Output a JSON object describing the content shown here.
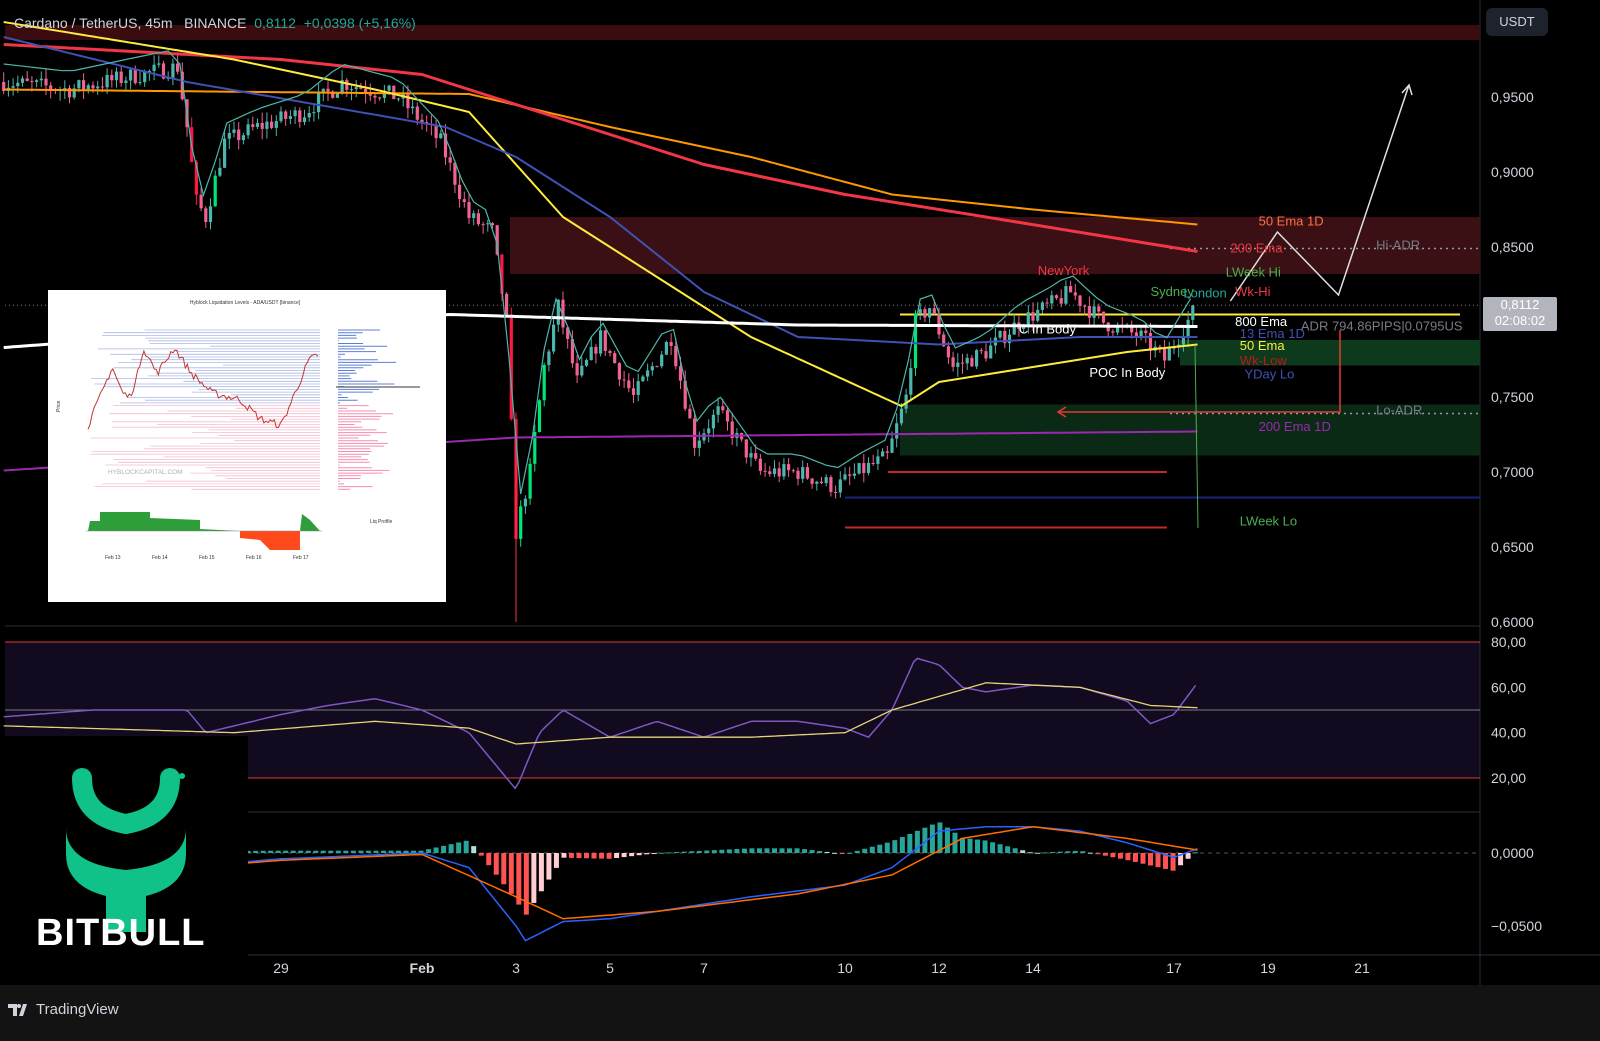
{
  "header": {
    "symbol": "Cardano / TetherUS, 45m",
    "exchange": "BINANCE",
    "last": "0,8112",
    "change": "+0,0398 (+5,16%)"
  },
  "currency_button": "USDT",
  "price_box": {
    "price": "0,8112",
    "countdown": "02:08:02"
  },
  "footer": {
    "brand": "TradingView"
  },
  "logo": {
    "text": "BITBULL"
  },
  "colors": {
    "up": "#26a69a",
    "down": "#f23645",
    "bright_up": "#00e676",
    "bg": "#000000",
    "logo_green": "#10c28a"
  },
  "chart_data": {
    "type": "candlestick",
    "title": "Cardano / TetherUS, 45m",
    "x_axis": {
      "unit": "days since Jan 29",
      "ticks": [
        {
          "day": 0,
          "label": "29"
        },
        {
          "day": 3,
          "label": "Feb"
        },
        {
          "day": 5,
          "label": "3"
        },
        {
          "day": 7,
          "label": "5"
        },
        {
          "day": 9,
          "label": "7"
        },
        {
          "day": 12,
          "label": "10"
        },
        {
          "day": 14,
          "label": "12"
        },
        {
          "day": 16,
          "label": "14"
        },
        {
          "day": 19,
          "label": "17"
        },
        {
          "day": 21,
          "label": "19"
        },
        {
          "day": 23,
          "label": "21"
        }
      ]
    },
    "price_axis": {
      "ylim": [
        0.6,
        1.0
      ],
      "ticks": [
        {
          "v": 0.95,
          "label": "0,9500"
        },
        {
          "v": 0.9,
          "label": "0,9000"
        },
        {
          "v": 0.85,
          "label": "0,8500"
        },
        {
          "v": 0.75,
          "label": "0,7500"
        },
        {
          "v": 0.7,
          "label": "0,7000"
        },
        {
          "v": 0.65,
          "label": "0,6500"
        },
        {
          "v": 0.6,
          "label": "0,6000"
        }
      ]
    },
    "price_path": [
      [
        -5.9,
        0.96
      ],
      [
        -4.5,
        0.955
      ],
      [
        -3,
        0.965
      ],
      [
        -2.2,
        0.97
      ],
      [
        -2.0,
        0.93
      ],
      [
        -1.8,
        0.88
      ],
      [
        -1.6,
        0.87
      ],
      [
        -1.2,
        0.92
      ],
      [
        -0.5,
        0.93
      ],
      [
        0.5,
        0.94
      ],
      [
        1.3,
        0.96
      ],
      [
        2.5,
        0.95
      ],
      [
        3.4,
        0.92
      ],
      [
        4.0,
        0.87
      ],
      [
        4.5,
        0.86
      ],
      [
        4.8,
        0.8
      ],
      [
        5.0,
        0.66
      ],
      [
        5.3,
        0.7
      ],
      [
        5.6,
        0.77
      ],
      [
        5.9,
        0.81
      ],
      [
        6.3,
        0.76
      ],
      [
        6.8,
        0.79
      ],
      [
        7.5,
        0.75
      ],
      [
        8.3,
        0.79
      ],
      [
        8.8,
        0.72
      ],
      [
        9.3,
        0.74
      ],
      [
        10.2,
        0.7
      ],
      [
        11,
        0.7
      ],
      [
        11.8,
        0.69
      ],
      [
        12.3,
        0.7
      ],
      [
        12.9,
        0.71
      ],
      [
        13.3,
        0.75
      ],
      [
        13.5,
        0.8
      ],
      [
        13.8,
        0.81
      ],
      [
        14.3,
        0.77
      ],
      [
        15,
        0.78
      ],
      [
        15.7,
        0.8
      ],
      [
        16.3,
        0.81
      ],
      [
        16.8,
        0.82
      ],
      [
        17.5,
        0.8
      ],
      [
        18.3,
        0.79
      ],
      [
        18.8,
        0.775
      ],
      [
        19.5,
        0.8112
      ]
    ],
    "indicators": [
      {
        "name": "50 Ema 1D",
        "color": "#ff9800",
        "points": [
          [
            -5.9,
            0.955
          ],
          [
            4,
            0.952
          ],
          [
            7,
            0.93
          ],
          [
            10,
            0.91
          ],
          [
            13,
            0.885
          ],
          [
            16,
            0.875
          ],
          [
            19.5,
            0.865
          ]
        ]
      },
      {
        "name": "200 Ema",
        "color": "#f23645",
        "points": [
          [
            -5.9,
            0.985
          ],
          [
            0,
            0.975
          ],
          [
            3,
            0.965
          ],
          [
            6,
            0.935
          ],
          [
            9,
            0.905
          ],
          [
            12,
            0.885
          ],
          [
            15,
            0.87
          ],
          [
            19.5,
            0.847
          ]
        ]
      },
      {
        "name": "50 Ema",
        "color": "#ffeb3b",
        "points": [
          [
            -5.9,
            1.0
          ],
          [
            -1,
            0.975
          ],
          [
            2,
            0.955
          ],
          [
            4,
            0.94
          ],
          [
            6,
            0.87
          ],
          [
            8,
            0.83
          ],
          [
            10,
            0.79
          ],
          [
            13.2,
            0.744
          ],
          [
            14,
            0.76
          ],
          [
            16,
            0.77
          ],
          [
            18,
            0.78
          ],
          [
            19.5,
            0.785
          ]
        ]
      },
      {
        "name": "13 Ema 1D",
        "color": "#3f51b5",
        "points": [
          [
            -5.9,
            0.99
          ],
          [
            -2,
            0.96
          ],
          [
            3.5,
            0.93
          ],
          [
            5,
            0.91
          ],
          [
            7,
            0.87
          ],
          [
            9,
            0.82
          ],
          [
            11,
            0.79
          ],
          [
            14,
            0.785
          ],
          [
            17,
            0.79
          ],
          [
            19.5,
            0.79
          ]
        ]
      },
      {
        "name": "800 Ema",
        "color": "#ffffff",
        "points": [
          [
            -5.9,
            0.783
          ],
          [
            3.6,
            0.805
          ],
          [
            11,
            0.798
          ],
          [
            19.5,
            0.797
          ]
        ]
      },
      {
        "name": "200 Ema 1D",
        "color": "#9c27b0",
        "points": [
          [
            -5.9,
            0.701
          ],
          [
            5,
            0.723
          ],
          [
            19.5,
            0.727
          ]
        ]
      }
    ],
    "levels": [
      {
        "name": "Hi-ADR",
        "price": 0.849,
        "style": "dotted"
      },
      {
        "name": "Lo-ADR",
        "price": 0.739,
        "style": "dotted"
      },
      {
        "name": "ADR 794.86PIPS|0.0795US",
        "price": 0.797
      }
    ],
    "labels": [
      {
        "text": "50 Ema 1D",
        "color": "#ff7043",
        "price": 0.867,
        "day": 20.8
      },
      {
        "text": "200 Ema",
        "color": "#f23645",
        "price": 0.849,
        "day": 20.2
      },
      {
        "text": "LWeek Hi",
        "color": "#4caf50",
        "price": 0.833,
        "day": 20.1
      },
      {
        "text": "NewYork",
        "color": "#f23645",
        "price": 0.834,
        "day": 16.1
      },
      {
        "text": "Sydney",
        "color": "#4caf50",
        "price": 0.82,
        "day": 18.5
      },
      {
        "text": "London",
        "color": "#26a69a",
        "price": 0.819,
        "day": 19.2
      },
      {
        "text": "Wk-Hi",
        "color": "#f23645",
        "price": 0.82,
        "day": 20.3
      },
      {
        "text": "800 Ema",
        "color": "#ffffff",
        "price": 0.8,
        "day": 20.3
      },
      {
        "text": "13 Ema 1D",
        "color": "#3f51b5",
        "price": 0.792,
        "day": 20.4
      },
      {
        "text": "50 Ema",
        "color": "#ffeb3b",
        "price": 0.784,
        "day": 20.4
      },
      {
        "text": "Wk-Low",
        "color": "#b71c1c",
        "price": 0.774,
        "day": 20.4
      },
      {
        "text": "YDay Lo",
        "color": "#3f51b5",
        "price": 0.765,
        "day": 20.5
      },
      {
        "text": "C In Body",
        "color": "#ffffff",
        "price": 0.795,
        "day": 15.7
      },
      {
        "text": "POC In Body",
        "color": "#ffffff",
        "price": 0.766,
        "day": 17.2
      },
      {
        "text": "200 Ema 1D",
        "color": "#9c27b0",
        "price": 0.73,
        "day": 20.8
      },
      {
        "text": "LWeek Lo",
        "color": "#4caf50",
        "price": 0.667,
        "day": 20.4
      },
      {
        "text": "Hi-ADR",
        "color": "#787b86",
        "price": 0.851,
        "day": 23.3
      },
      {
        "text": "Lo-ADR",
        "color": "#787b86",
        "price": 0.741,
        "day": 23.3
      },
      {
        "text": "ADR 794.86PIPS|0.0795US",
        "color": "#787b86",
        "price": 0.797,
        "day": 21.7
      }
    ],
    "projection": [
      [
        20.2,
        0.814
      ],
      [
        21.2,
        0.86
      ],
      [
        22.5,
        0.818
      ],
      [
        24.0,
        0.958
      ]
    ],
    "rsi": {
      "ticks": [
        {
          "v": 80,
          "label": "80,00"
        },
        {
          "v": 60,
          "label": "60,00"
        },
        {
          "v": 40,
          "label": "40,00"
        },
        {
          "v": 20,
          "label": "20,00"
        }
      ],
      "bands": [
        80,
        50,
        20
      ],
      "line": [
        [
          -5.9,
          47
        ],
        [
          -4,
          50
        ],
        [
          -2,
          50
        ],
        [
          -1.6,
          40
        ],
        [
          0,
          48
        ],
        [
          1,
          52
        ],
        [
          2,
          55
        ],
        [
          3,
          50
        ],
        [
          4,
          40
        ],
        [
          5,
          15
        ],
        [
          5.5,
          40
        ],
        [
          6,
          50
        ],
        [
          7,
          38
        ],
        [
          8,
          45
        ],
        [
          9,
          38
        ],
        [
          10,
          45
        ],
        [
          11,
          45
        ],
        [
          12,
          42
        ],
        [
          12.5,
          38
        ],
        [
          13,
          50
        ],
        [
          13.5,
          73
        ],
        [
          14,
          70
        ],
        [
          14.5,
          60
        ],
        [
          15,
          58
        ],
        [
          16,
          61
        ],
        [
          17,
          60
        ],
        [
          18,
          54
        ],
        [
          18.5,
          44
        ],
        [
          19,
          48
        ],
        [
          19.5,
          62
        ]
      ],
      "ma": [
        [
          -5.9,
          43
        ],
        [
          -1,
          40
        ],
        [
          2,
          45
        ],
        [
          4,
          42
        ],
        [
          5,
          35
        ],
        [
          7,
          38
        ],
        [
          10,
          38
        ],
        [
          12,
          40
        ],
        [
          13,
          50
        ],
        [
          15,
          62
        ],
        [
          17,
          60
        ],
        [
          18.5,
          52
        ],
        [
          19.5,
          51
        ]
      ]
    },
    "macd": {
      "ticks": [
        {
          "v": 0,
          "label": "0,0000"
        },
        {
          "v": -0.05,
          "label": "−0,0500"
        }
      ],
      "macd": [
        [
          -5.9,
          -0.017
        ],
        [
          -3,
          -0.012
        ],
        [
          0,
          -0.004
        ],
        [
          3,
          0
        ],
        [
          4,
          -0.01
        ],
        [
          5,
          -0.05
        ],
        [
          5.2,
          -0.06
        ],
        [
          6,
          -0.047
        ],
        [
          7,
          -0.045
        ],
        [
          8,
          -0.04
        ],
        [
          10,
          -0.03
        ],
        [
          12,
          -0.022
        ],
        [
          13,
          -0.01
        ],
        [
          14,
          0.015
        ],
        [
          15,
          0.018
        ],
        [
          16,
          0.018
        ],
        [
          17,
          0.015
        ],
        [
          18,
          0.007
        ],
        [
          19,
          -0.003
        ],
        [
          19.5,
          0.003
        ]
      ],
      "signal": [
        [
          -5.9,
          -0.02
        ],
        [
          0,
          -0.005
        ],
        [
          3,
          -0.001
        ],
        [
          5,
          -0.03
        ],
        [
          6,
          -0.045
        ],
        [
          8,
          -0.04
        ],
        [
          11,
          -0.028
        ],
        [
          13,
          -0.015
        ],
        [
          14.5,
          0.01
        ],
        [
          16,
          0.018
        ],
        [
          18,
          0.01
        ],
        [
          19.5,
          0.002
        ]
      ]
    },
    "inset": {
      "title": "Hyblock Liquidation Levels - ADA/USDT [binance]",
      "watermark": "HYBLOCKCAPITAL.COM",
      "xlabels": [
        "Feb 13",
        "Feb 14",
        "Feb 15",
        "Feb 16",
        "Feb 17"
      ],
      "ylabel": "Price",
      "profile_label": "Liq Profile"
    }
  }
}
